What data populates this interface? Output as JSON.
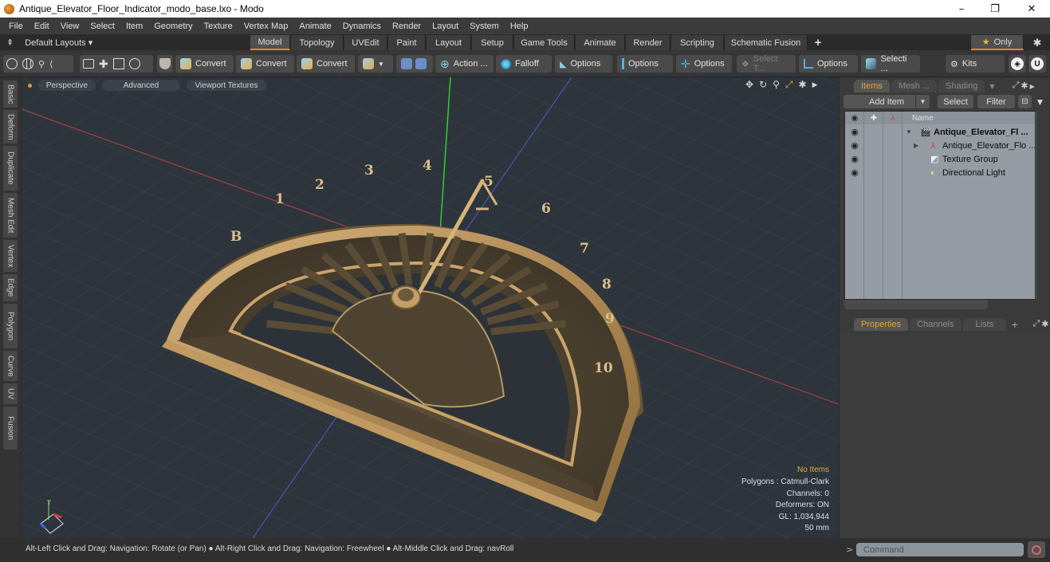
{
  "window": {
    "title": "Antique_Elevator_Floor_Indicator_modo_base.lxo - Modo",
    "minimize": "–",
    "maximize": "❐",
    "close": "✕"
  },
  "menu": [
    "File",
    "Edit",
    "View",
    "Select",
    "Item",
    "Geometry",
    "Texture",
    "Vertex Map",
    "Animate",
    "Dynamics",
    "Render",
    "Layout",
    "System",
    "Help"
  ],
  "layouts": {
    "default_label": "Default Layouts ▾",
    "tabs": [
      "Model",
      "Topology",
      "UVEdit",
      "Paint",
      "Layout",
      "Setup",
      "Game Tools",
      "Animate",
      "Render",
      "Scripting",
      "Schematic Fusion"
    ],
    "active_tab": "Model",
    "add_tab": "+",
    "only_label": "Only",
    "star": "★"
  },
  "toolbar": {
    "convert1": "Convert",
    "convert2": "Convert",
    "convert3": "Convert",
    "action": "Action ...",
    "falloff": "Falloff",
    "options1": "Options",
    "options2": "Options",
    "options3": "Options",
    "select_t": "Select T...",
    "options4": "Options",
    "selecti": "Selecti ...",
    "kits": "Kits"
  },
  "left_tabs": [
    "Basic",
    "Deform",
    "Duplicate",
    "Mesh Edit",
    "Vertex",
    "Edge",
    "Polygon",
    "Curve",
    "UV",
    "Fusion"
  ],
  "viewport": {
    "perspective": "Perspective",
    "advanced": "Advanced",
    "textures": "Viewport Textures",
    "dial_numbers": [
      "B",
      "1",
      "2",
      "3",
      "4",
      "5",
      "6",
      "7",
      "8",
      "9",
      "10"
    ],
    "stats": {
      "items": "No Items",
      "polygons": "Polygons : Catmull-Clark",
      "channels": "Channels: 0",
      "deformers": "Deformers: ON",
      "gl": "GL: 1,034,944",
      "scale": "50 mm"
    }
  },
  "items_panel": {
    "tabs": [
      "Items",
      "Mesh ...",
      "Shading"
    ],
    "active_tab": "Items",
    "add_item": "Add Item",
    "select": "Select",
    "filter": "Filter",
    "name_header": "Name",
    "rows": [
      {
        "label": "Antique_Elevator_Fl ...",
        "icon": "scene-icon",
        "bold": true
      },
      {
        "label": "Antique_Elevator_Flo ...",
        "icon": "mesh-locator-icon",
        "bold": false
      },
      {
        "label": "Texture Group",
        "icon": "texture-group-icon",
        "bold": false
      },
      {
        "label": "Directional Light",
        "icon": "light-icon",
        "bold": false
      }
    ]
  },
  "properties_panel": {
    "tabs": [
      "Properties",
      "Channels",
      "Lists"
    ],
    "active_tab": "Properties",
    "add": "+"
  },
  "status": {
    "message": "Alt-Left Click and Drag: Navigation: Rotate (or Pan) ● Alt-Right Click and Drag: Navigation: Freewheel ● Alt-Middle Click and Drag: navRoll",
    "command_placeholder": "Command",
    "prompt": ">"
  }
}
